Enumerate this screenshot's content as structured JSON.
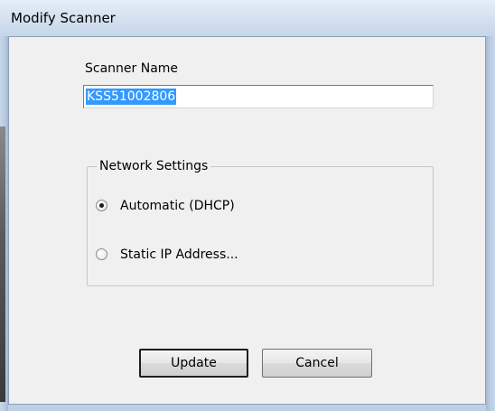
{
  "window": {
    "title": "Modify Scanner"
  },
  "form": {
    "scanner_name_label": "Scanner Name",
    "scanner_name_value": "KSS51002806"
  },
  "network_settings": {
    "legend": "Network Settings",
    "options": [
      {
        "label": "Automatic (DHCP)",
        "selected": true
      },
      {
        "label": "Static IP Address...",
        "selected": false
      }
    ]
  },
  "buttons": {
    "update_label": "Update",
    "cancel_label": "Cancel"
  },
  "colors": {
    "selection_highlight": "#3399ff",
    "dialog_background": "#f0f0f0",
    "titlebar": "#d3e0ef"
  }
}
